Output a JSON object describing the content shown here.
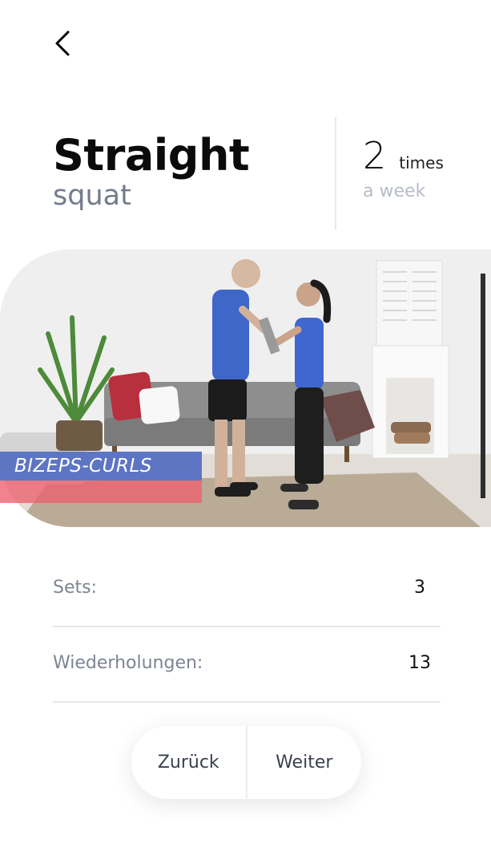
{
  "header": {
    "back_icon": "chevron-left-icon"
  },
  "exercise": {
    "title": "Straight",
    "subtitle": "squat"
  },
  "frequency": {
    "count": "2",
    "unit": "times",
    "period": "a week"
  },
  "media": {
    "overlay_label": "BIZEPS-CURLS",
    "label_color": "#5d75c3",
    "accent_color": "#ec606e"
  },
  "stats": [
    {
      "label": "Sets:",
      "value": "3"
    },
    {
      "label": "Wiederholungen:",
      "value": "13"
    }
  ],
  "actions": {
    "back_label": "Zurück",
    "next_label": "Weiter"
  }
}
